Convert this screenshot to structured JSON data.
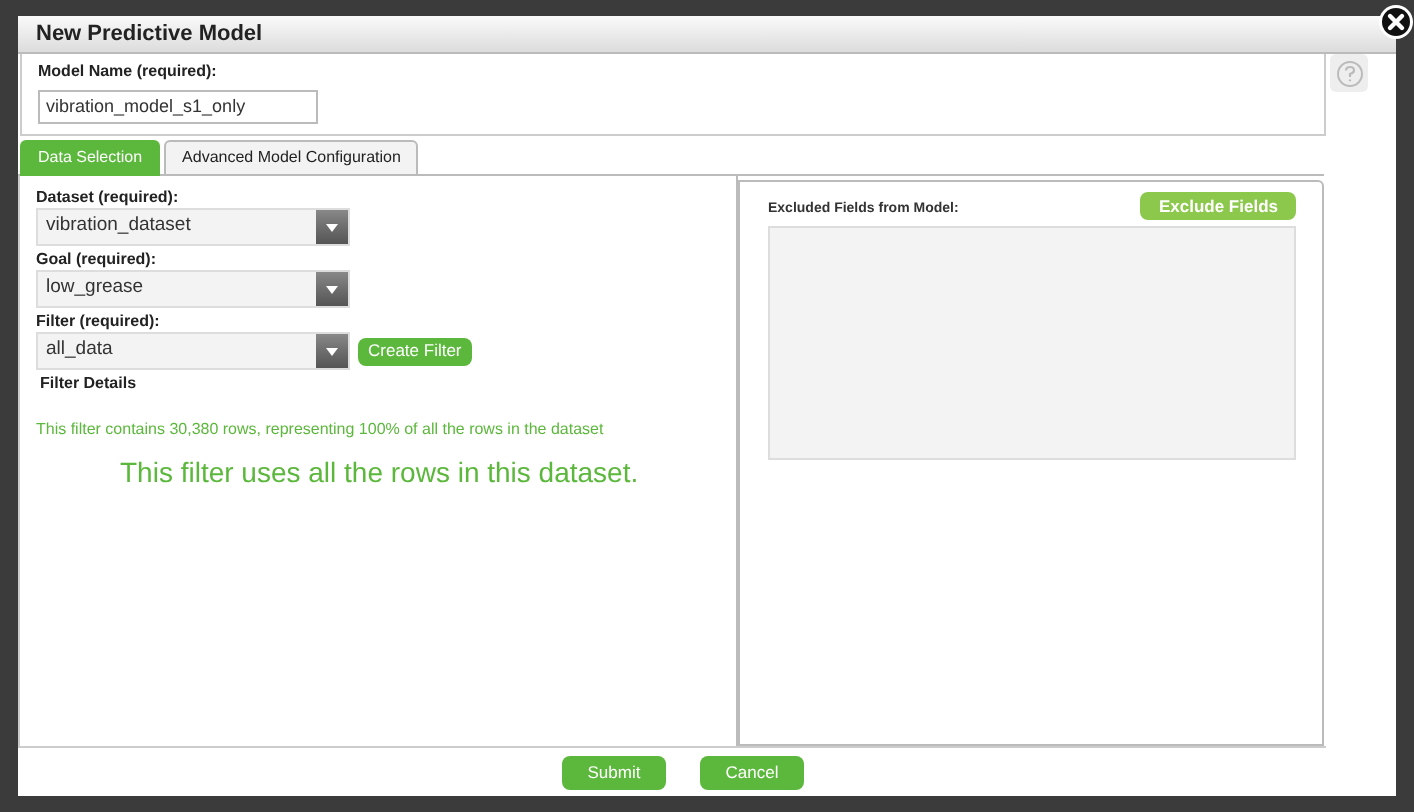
{
  "dialog": {
    "title": "New Predictive Model"
  },
  "model_name": {
    "label": "Model Name (required):",
    "value": "vibration_model_s1_only"
  },
  "tabs": [
    {
      "label": "Data Selection",
      "selected": true
    },
    {
      "label": "Advanced Model Configuration",
      "selected": false
    }
  ],
  "selects": [
    {
      "label": "Dataset (required):",
      "value": "vibration_dataset"
    },
    {
      "label": "Goal (required):",
      "value": "low_grease"
    },
    {
      "label": "Filter (required):",
      "value": "all_data",
      "button": "Create Filter"
    }
  ],
  "filter_details": {
    "heading": "Filter Details",
    "summary": "This filter contains 30,380 rows, representing 100% of all the rows in the dataset",
    "message": "This filter uses all the rows in this dataset."
  },
  "excluded": {
    "label": "Excluded Fields from Model:",
    "button": "Exclude Fields"
  },
  "buttons": [
    "Submit",
    "Cancel"
  ]
}
